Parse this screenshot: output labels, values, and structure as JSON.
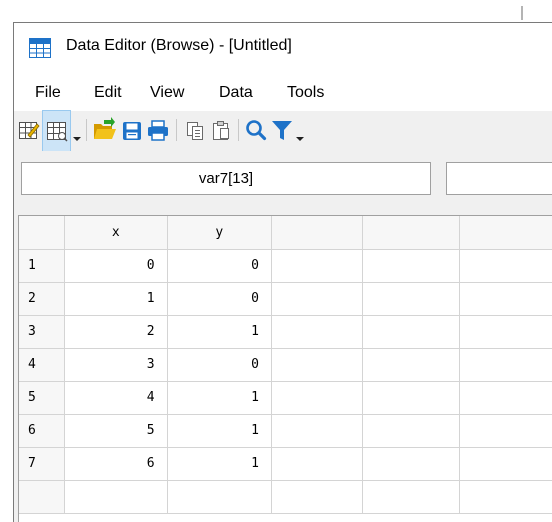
{
  "window": {
    "title": "Data Editor (Browse) - [Untitled]"
  },
  "menu": {
    "items": [
      "File",
      "Edit",
      "View",
      "Data",
      "Tools"
    ]
  },
  "toolbar": {
    "icons": [
      "edit-mode-icon",
      "browse-mode-icon",
      "dropdown-arrow-icon",
      "open-folder-icon",
      "save-icon",
      "print-icon",
      "copy-icon",
      "paste-icon",
      "search-icon",
      "filter-icon",
      "dropdown-arrow-icon"
    ]
  },
  "cellbar": {
    "reference": "var7[13]",
    "value": ""
  },
  "grid": {
    "columns": [
      "x",
      "y",
      "",
      "",
      ""
    ],
    "rows": [
      {
        "num": "1",
        "cells": [
          "0",
          "0"
        ]
      },
      {
        "num": "2",
        "cells": [
          "1",
          "0"
        ]
      },
      {
        "num": "3",
        "cells": [
          "2",
          "1"
        ]
      },
      {
        "num": "4",
        "cells": [
          "3",
          "0"
        ]
      },
      {
        "num": "5",
        "cells": [
          "4",
          "1"
        ]
      },
      {
        "num": "6",
        "cells": [
          "5",
          "1"
        ]
      },
      {
        "num": "7",
        "cells": [
          "6",
          "1"
        ]
      },
      {
        "num": "",
        "cells": [
          "",
          ""
        ]
      }
    ]
  },
  "colors": {
    "accent_blue": "#1e72c8",
    "folder_yellow": "#e8b400",
    "grid_line": "#d4d4d4",
    "header_bg": "#f7f7f7"
  }
}
